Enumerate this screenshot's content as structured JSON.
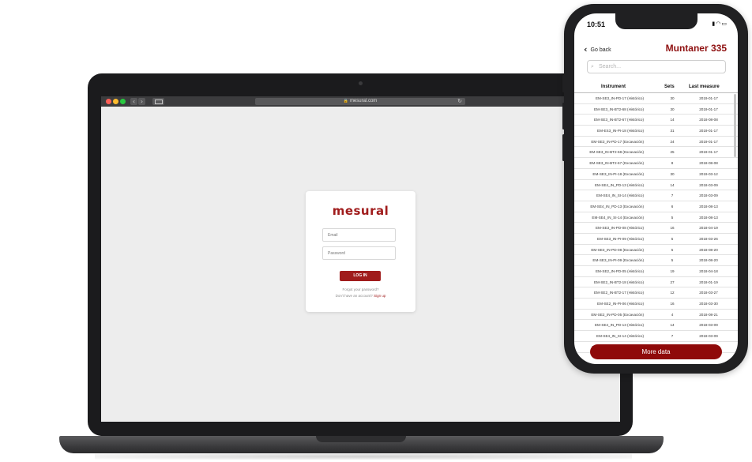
{
  "browser": {
    "url": "mesural.com",
    "lock_icon": "lock-icon",
    "reload_icon": "reload-icon"
  },
  "login": {
    "logo_text": "mesural",
    "email_placeholder": "Email",
    "password_placeholder": "Password",
    "login_button": "LOG IN",
    "forgot_password": "Forgot your password?",
    "no_account": "Don't have an account?",
    "signup_link": "Sign up",
    "accent_color": "#a01c1c"
  },
  "phone": {
    "status_time": "10:51",
    "back_label": "Go back",
    "title": "Muntaner 335",
    "search_placeholder": "Search...",
    "columns": [
      "Instrument",
      "Sets",
      "Last measure"
    ],
    "rows": [
      [
        "EM-SE3_IN-PD-17 (Histórico)",
        "30",
        "2019-01-17"
      ],
      [
        "EM-SE3_IN-BT2-68 (Histórico)",
        "30",
        "2019-01-17"
      ],
      [
        "EM-SE3_IN-BT2-67 (Histórico)",
        "14",
        "2018-08-08"
      ],
      [
        "EM-ES3_IN-PI-18 (Histórico)",
        "31",
        "2019-01-17"
      ],
      [
        "EM-SE3_IN-PD-17 (Excavación)",
        "24",
        "2019-01-17"
      ],
      [
        "EM-SE3_IN-BT2-68 (Excavación)",
        "25",
        "2019-01-17"
      ],
      [
        "EM-SE3_IN-BT2-67 (Excavación)",
        "8",
        "2018-08-08"
      ],
      [
        "EM-SE3_IN-PI-18 (Excavación)",
        "30",
        "2019-03-12"
      ],
      [
        "EM-SE4_IN_PD-13 (Histórico)",
        "14",
        "2018-03-09"
      ],
      [
        "EM-SE4_IN_SI-14 (Histórico)",
        "7",
        "2018-03-09"
      ],
      [
        "EM-SE4_IN_PD-13 (Excavación)",
        "6",
        "2018-08-13"
      ],
      [
        "EM-SE4_IN_SI-14 (Excavación)",
        "5",
        "2018-08-13"
      ],
      [
        "EM-SE3_IN-PD-08 (Histórico)",
        "16",
        "2018-04-19"
      ],
      [
        "EM-SE3_IN-PI-09 (Histórico)",
        "5",
        "2018-03-26"
      ],
      [
        "EM-SE3_IN-PD-08 (Excavación)",
        "5",
        "2018-08-20"
      ],
      [
        "EM-SE3_IN-PI-09 (Excavación)",
        "5",
        "2018-08-20"
      ],
      [
        "EM-SE2_IN-PD-05 (Histórico)",
        "19",
        "2018-04-18"
      ],
      [
        "EM-SE2_IN-BT2-18 (Histórico)",
        "27",
        "2018-01-19"
      ],
      [
        "EM-SE2_IN-BT2-17 (Histórico)",
        "12",
        "2018-03-27"
      ],
      [
        "EM-SE2_IN-PI-06 (Histórico)",
        "16",
        "2018-03-30"
      ],
      [
        "EM-SE2_IN-PD-05 (Excavación)",
        "4",
        "2018-08-21"
      ],
      [
        "EM-SE4_IN_PD-13 (Histórico)",
        "14",
        "2018-03-09"
      ],
      [
        "EM-SE4_IN_SI-14 (Histórico)",
        "7",
        "2018-03-09"
      ],
      [
        "EM-SE4_IN_SI-14 (Excavación)",
        "5",
        "2018-08-13"
      ]
    ],
    "more_button": "More data",
    "accent_color": "#8f1111"
  }
}
